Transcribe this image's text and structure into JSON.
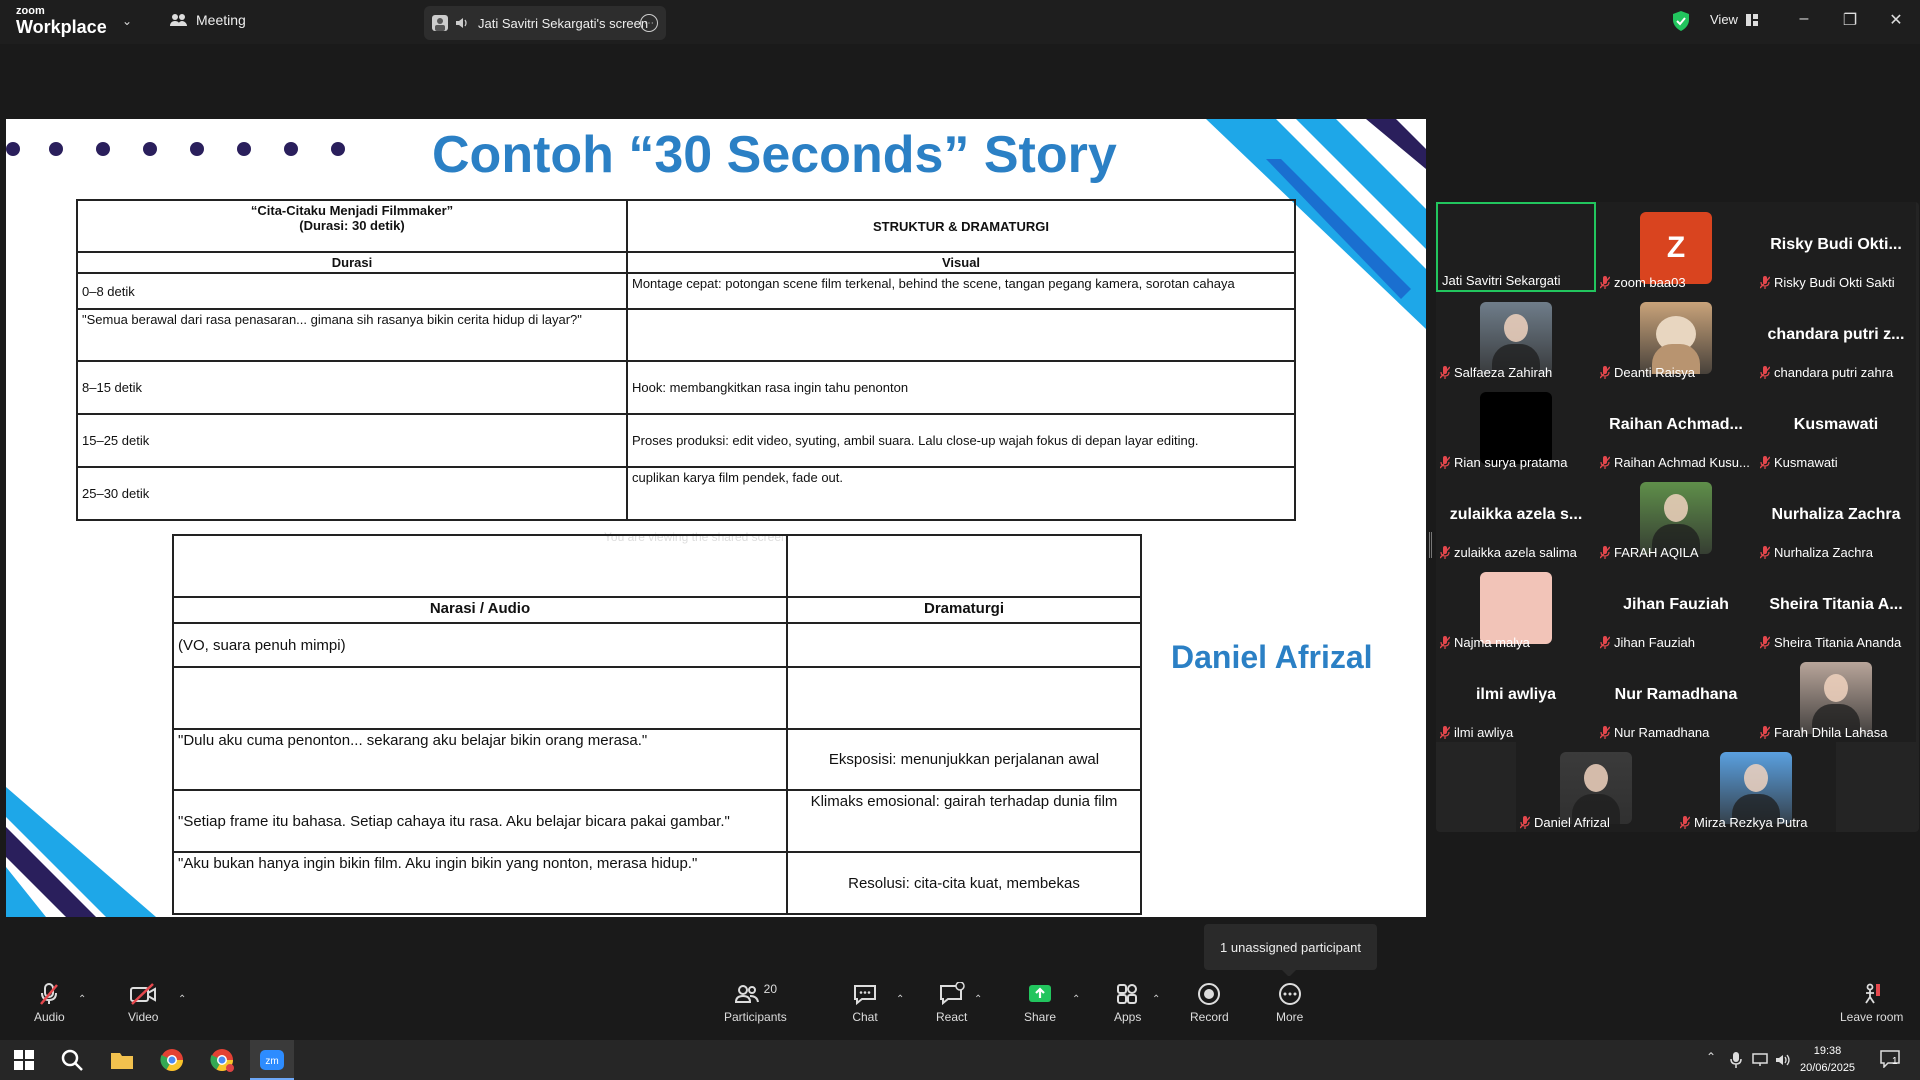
{
  "app": {
    "logo_top": "zoom",
    "logo_bottom": "Workplace",
    "meeting_tab": "Meeting",
    "share_tab": "Jati Savitri Sekargati's screen",
    "view_label": "View"
  },
  "slide": {
    "title": "Contoh “30 Seconds” Story",
    "presenter": "Daniel Afrizal",
    "ghost_text": "You are viewing the shared screen",
    "table1": {
      "title_line1": "“Cita-Citaku Menjadi Filmmaker”",
      "title_line2": "(Durasi: 30 detik)",
      "struktur": "STRUKTUR & DRAMATURGI",
      "col_durasi": "Durasi",
      "col_visual": "Visual",
      "rows": [
        {
          "left": "0–8 detik",
          "right": "Montage cepat: potongan scene film terkenal, behind the scene, tangan pegang kamera, sorotan cahaya"
        },
        {
          "left": "\"Semua berawal dari rasa penasaran... gimana sih rasanya bikin cerita hidup di layar?\"",
          "right": ""
        },
        {
          "left": "8–15 detik",
          "right": "Hook: membangkitkan rasa ingin tahu penonton"
        },
        {
          "left": "15–25 detik",
          "right": "Proses produksi: edit video, syuting, ambil suara. Lalu close-up wajah fokus di depan layar editing."
        },
        {
          "left": "25–30 detik",
          "right": " cuplikan karya film pendek, fade out."
        }
      ]
    },
    "table2": {
      "col_narasi": "Narasi / Audio",
      "col_dramaturgi": "Dramaturgi",
      "rows": [
        {
          "left": "(VO, suara penuh mimpi)",
          "right": ""
        },
        {
          "left": "",
          "right": ""
        },
        {
          "left": "\"Dulu aku cuma penonton... sekarang aku belajar bikin orang merasa.\"",
          "right": "Eksposisi: menunjukkan perjalanan awal"
        },
        {
          "left": "\"Setiap frame itu bahasa. Setiap cahaya itu rasa. Aku belajar bicara pakai gambar.\"",
          "right": "Klimaks emosional: gairah terhadap dunia film"
        },
        {
          "left": "\"Aku bukan hanya ingin bikin film. Aku ingin bikin yang nonton, merasa hidup.\"",
          "right": "Resolusi: cita-cita kuat, membekas"
        }
      ]
    }
  },
  "gallery": {
    "tiles": [
      {
        "name": "Jati Savitri Sekargati",
        "big": "",
        "avatar": "none",
        "muted": false,
        "active": true
      },
      {
        "name": "zoom baa03",
        "big": "",
        "avatar": "letter",
        "letter": "Z",
        "color": "#d9441f",
        "muted": true
      },
      {
        "name": "Risky Budi Okti Sakti",
        "big": "Risky Budi Okti...",
        "avatar": "none",
        "muted": true
      },
      {
        "name": "Salfaeza Zahirah",
        "big": "",
        "avatar": "photo",
        "color": "#6f7d8a",
        "muted": true
      },
      {
        "name": "Deanti Raisya",
        "big": "",
        "avatar": "cat",
        "color": "#c9a37a",
        "muted": true
      },
      {
        "name": "chandara putri zahra",
        "big": "chandara putri z...",
        "avatar": "none",
        "muted": true
      },
      {
        "name": "Rian surya pratama",
        "big": "",
        "avatar": "black",
        "color": "#000000",
        "muted": true
      },
      {
        "name": "Raihan Achmad Kusu...",
        "big": "Raihan Achmad...",
        "avatar": "none",
        "muted": true
      },
      {
        "name": "Kusmawati",
        "big": "Kusmawati",
        "avatar": "none",
        "muted": true
      },
      {
        "name": "zulaikka azela salima",
        "big": "zulaikka azela s...",
        "avatar": "none",
        "muted": true
      },
      {
        "name": "FARAH AQILA",
        "big": "",
        "avatar": "photo",
        "color": "#5f8f4a",
        "muted": true
      },
      {
        "name": "Nurhaliza Zachra",
        "big": "Nurhaliza Zachra",
        "avatar": "none",
        "muted": true
      },
      {
        "name": "Najma malya",
        "big": "",
        "avatar": "solid",
        "color": "#f2c4b8",
        "muted": true
      },
      {
        "name": "Jihan Fauziah",
        "big": "Jihan Fauziah",
        "avatar": "none",
        "muted": true
      },
      {
        "name": "Sheira Titania Ananda",
        "big": "Sheira Titania A...",
        "avatar": "none",
        "muted": true
      },
      {
        "name": "ilmi awliya",
        "big": "ilmi awliya",
        "avatar": "none",
        "muted": true
      },
      {
        "name": "Nur Ramadhana",
        "big": "Nur Ramadhana",
        "avatar": "none",
        "muted": true
      },
      {
        "name": "Farah Dhila Lahasa",
        "big": "",
        "avatar": "photo",
        "color": "#b8a59a",
        "muted": true
      },
      {
        "name": "Daniel Afrizal",
        "big": "",
        "avatar": "photo",
        "color": "#3b3b3b",
        "muted": true
      },
      {
        "name": "Mirza Rezkya Putra",
        "big": "",
        "avatar": "photo",
        "color": "#5aa0e0",
        "muted": true
      }
    ]
  },
  "tooltip": "1 unassigned participant",
  "toolbar": {
    "audio": "Audio",
    "video": "Video",
    "participants": "Participants",
    "participants_count": "20",
    "chat": "Chat",
    "react": "React",
    "share": "Share",
    "apps": "Apps",
    "record": "Record",
    "more": "More",
    "leave": "Leave room"
  },
  "taskbar": {
    "time": "19:38",
    "date": "20/06/2025",
    "notification_count": "1"
  },
  "colors": {
    "accent_blue": "#2b80c5",
    "active_green": "#22c55e",
    "muted_red": "#e5484d",
    "share_green": "#22c55e"
  }
}
